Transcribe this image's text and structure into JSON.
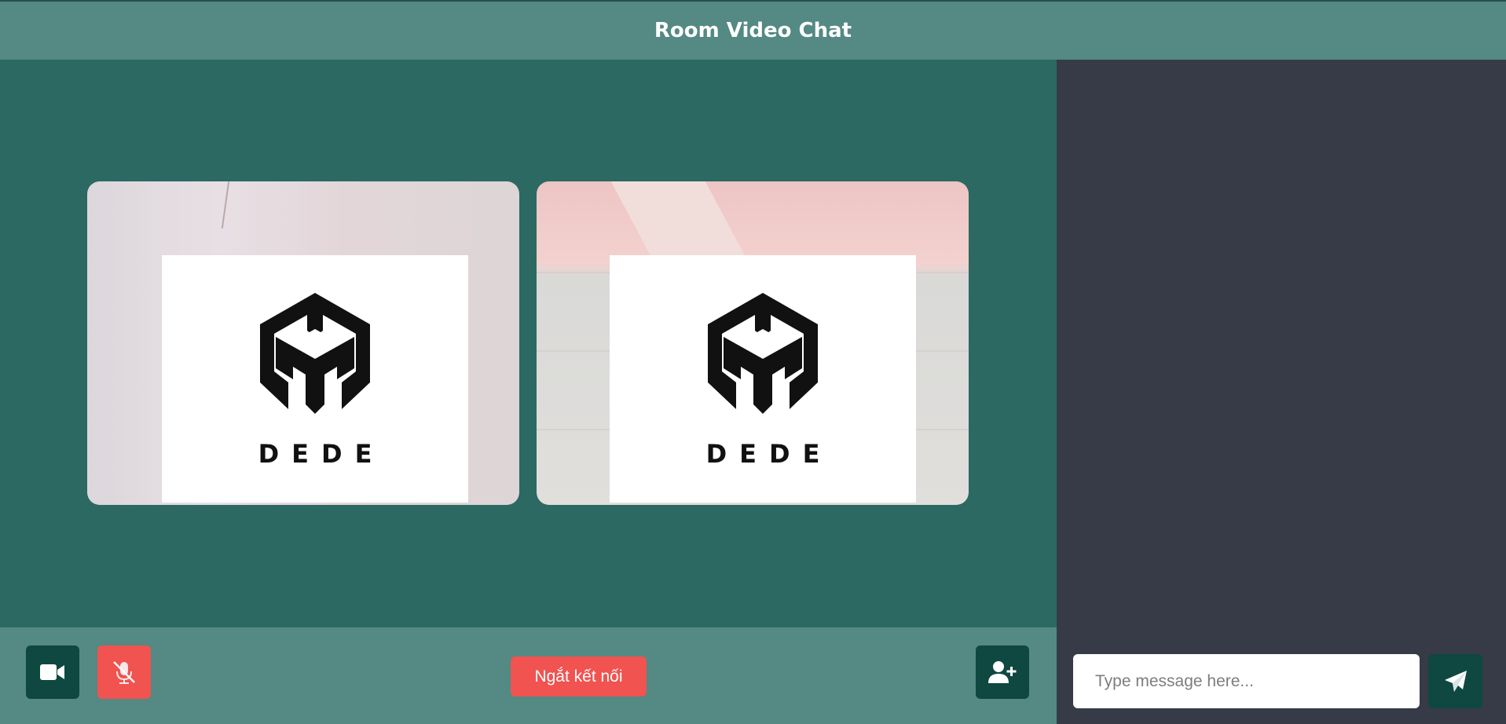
{
  "header": {
    "title": "Room Video Chat"
  },
  "participants": [
    {
      "logo_text": "DEDE"
    },
    {
      "logo_text": "DEDE"
    }
  ],
  "controls": {
    "video_icon": "video-camera-icon",
    "mic_icon": "microphone-muted-icon",
    "disconnect_label": "Ngắt kết nối",
    "add_user_icon": "user-plus-icon"
  },
  "chat": {
    "input_placeholder": "Type message here...",
    "send_icon": "paper-plane-icon"
  },
  "colors": {
    "header_bg": "#548984",
    "stage_bg": "#2c6962",
    "chat_bg": "#363b47",
    "dark_button": "#0f4741",
    "danger_button": "#f05350"
  }
}
